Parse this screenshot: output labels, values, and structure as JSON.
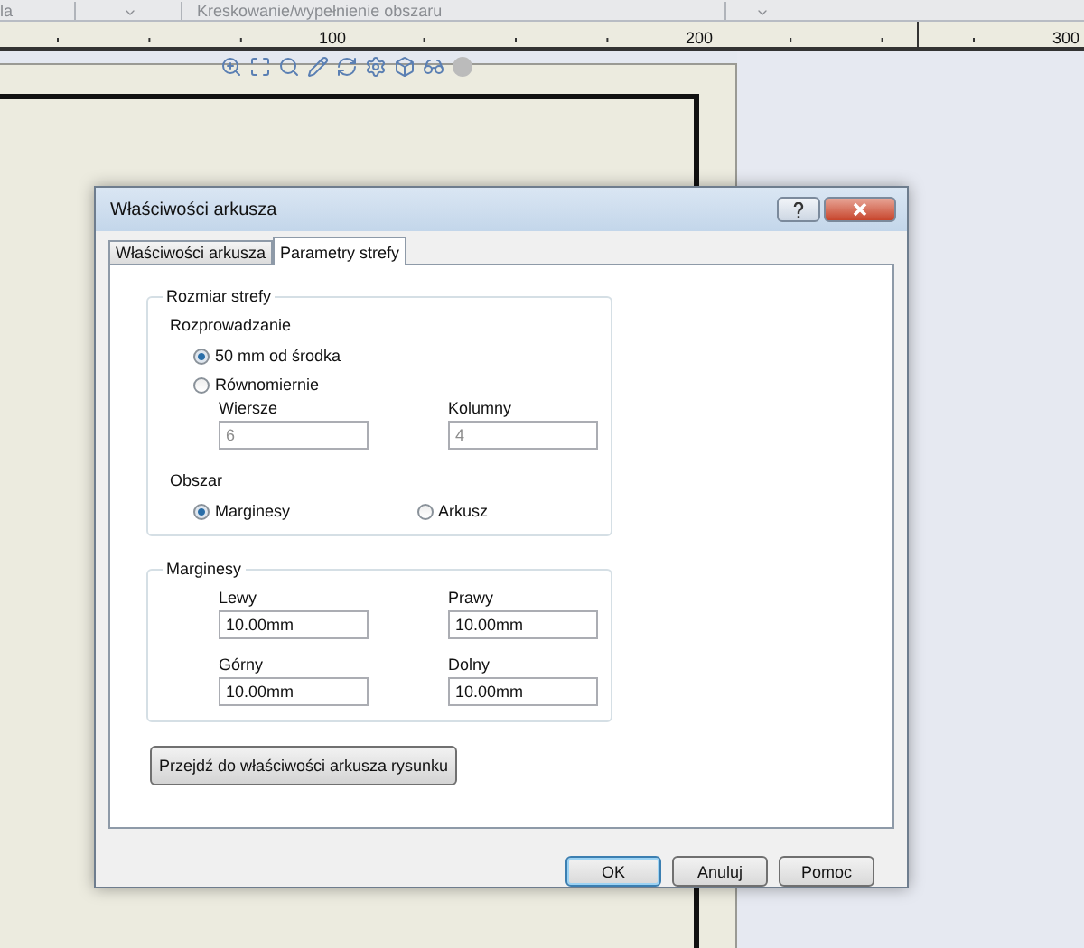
{
  "toolbar": {
    "left_text": "la",
    "hatch_label": "Kreskowanie/wypełnienie obszaru"
  },
  "ruler": {
    "labels": [
      "100",
      "200",
      "300"
    ]
  },
  "dialog": {
    "title": "Właściwości arkusza",
    "tabs": [
      {
        "label": "Właściwości arkusza",
        "selected": false
      },
      {
        "label": "Parametry strefy",
        "selected": true
      }
    ],
    "zone_group": {
      "title": "Rozmiar strefy",
      "distribution_label": "Rozprowadzanie",
      "distribution_options": [
        {
          "label": "50 mm od środka",
          "selected": true
        },
        {
          "label": "Równomiernie",
          "selected": false
        }
      ],
      "fields": [
        {
          "label": "Wiersze",
          "value": "6",
          "disabled": true
        },
        {
          "label": "Kolumny",
          "value": "4",
          "disabled": true
        }
      ],
      "area_label": "Obszar",
      "area_options": [
        {
          "label": "Marginesy",
          "selected": true
        },
        {
          "label": "Arkusz",
          "selected": false
        }
      ]
    },
    "margins_group": {
      "title": "Marginesy",
      "fields": [
        {
          "label": "Lewy",
          "value": "10.00mm",
          "disabled": false
        },
        {
          "label": "Prawy",
          "value": "10.00mm",
          "disabled": false
        },
        {
          "label": "Górny",
          "value": "10.00mm",
          "disabled": false
        },
        {
          "label": "Dolny",
          "value": "10.00mm",
          "disabled": false
        }
      ]
    },
    "sheet_button": "Przejdź do właściwości arkusza rysunku",
    "buttons": [
      {
        "label": "OK",
        "default": true
      },
      {
        "label": "Anuluj",
        "default": false
      },
      {
        "label": "Pomoc",
        "default": false
      }
    ]
  }
}
